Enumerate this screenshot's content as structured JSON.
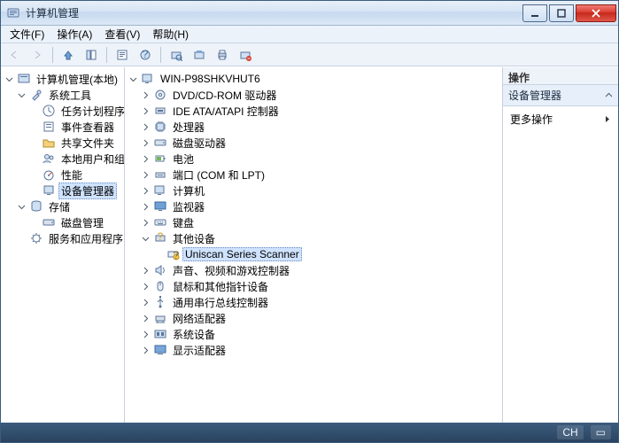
{
  "window": {
    "title": "计算机管理"
  },
  "menu": {
    "file": "文件(F)",
    "action": "操作(A)",
    "view": "查看(V)",
    "help": "帮助(H)"
  },
  "toolbar": {
    "back": "back",
    "forward": "forward",
    "up": "up",
    "show_hide": "show-hide-tree",
    "properties": "properties",
    "help": "help",
    "scan": "scan",
    "refresh": "refresh",
    "print": "print",
    "uninstall": "uninstall"
  },
  "left_tree": {
    "root": "计算机管理(本地)",
    "groups": [
      {
        "label": "系统工具",
        "children": [
          {
            "label": "任务计划程序",
            "icon": "clock-icon"
          },
          {
            "label": "事件查看器",
            "icon": "event-icon"
          },
          {
            "label": "共享文件夹",
            "icon": "folder-share-icon"
          },
          {
            "label": "本地用户和组",
            "icon": "users-icon"
          },
          {
            "label": "性能",
            "icon": "perf-icon"
          },
          {
            "label": "设备管理器",
            "icon": "device-mgr-icon",
            "selected": true
          }
        ]
      },
      {
        "label": "存储",
        "children": [
          {
            "label": "磁盘管理",
            "icon": "disk-icon"
          }
        ]
      },
      {
        "label": "服务和应用程序",
        "icon": "services-icon",
        "children": []
      }
    ]
  },
  "center_tree": {
    "root": "WIN-P98SHKVHUT6",
    "categories": [
      {
        "label": "DVD/CD-ROM 驱动器",
        "icon": "optical-icon"
      },
      {
        "label": "IDE ATA/ATAPI 控制器",
        "icon": "ide-icon"
      },
      {
        "label": "处理器",
        "icon": "cpu-icon"
      },
      {
        "label": "磁盘驱动器",
        "icon": "disk-icon"
      },
      {
        "label": "电池",
        "icon": "battery-icon"
      },
      {
        "label": "端口 (COM 和 LPT)",
        "icon": "port-icon"
      },
      {
        "label": "计算机",
        "icon": "computer-icon"
      },
      {
        "label": "监视器",
        "icon": "monitor-icon"
      },
      {
        "label": "键盘",
        "icon": "keyboard-icon"
      },
      {
        "label": "其他设备",
        "icon": "other-icon",
        "expanded": true,
        "children": [
          {
            "label": "Uniscan Series Scanner",
            "icon": "unknown-device-icon",
            "selected": true
          }
        ]
      },
      {
        "label": "声音、视频和游戏控制器",
        "icon": "sound-icon"
      },
      {
        "label": "鼠标和其他指针设备",
        "icon": "mouse-icon"
      },
      {
        "label": "通用串行总线控制器",
        "icon": "usb-icon"
      },
      {
        "label": "网络适配器",
        "icon": "network-icon"
      },
      {
        "label": "系统设备",
        "icon": "system-icon"
      },
      {
        "label": "显示适配器",
        "icon": "display-icon"
      }
    ]
  },
  "actions": {
    "header": "操作",
    "section": "设备管理器",
    "more": "更多操作"
  },
  "status": {
    "lang": "CH",
    "ime": "▭"
  }
}
